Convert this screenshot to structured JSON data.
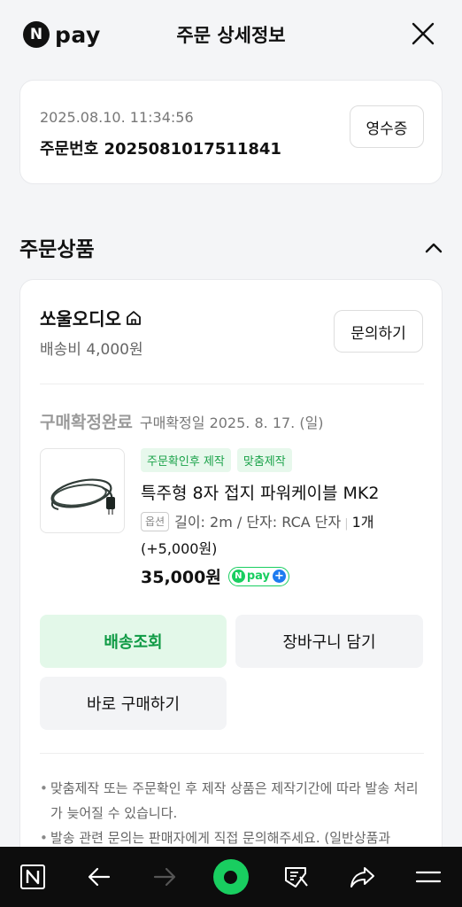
{
  "header": {
    "logo_letter": "N",
    "logo_text": "pay",
    "title": "주문 상세정보"
  },
  "order": {
    "datetime": "2025.08.10. 11:34:56",
    "number_label": "주문번호",
    "number": "2025081017511841",
    "receipt_label": "영수증"
  },
  "section": {
    "title": "주문상품"
  },
  "seller": {
    "name": "쏘울오디오",
    "shipping_fee": "배송비 4,000원",
    "inquiry_label": "문의하기"
  },
  "item": {
    "status": "구매확정완료",
    "confirm_date": "구매확정일 2025. 8. 17. (일)",
    "tags": [
      "주문확인후 제작",
      "맞춤제작"
    ],
    "name": "특주형 8자 접지 파워케이블 MK2",
    "option_badge": "옵션",
    "option_text": "길이: 2m / 단자: RCA 단자",
    "quantity_text": "1개 (+5,000원)",
    "price": "35,000원",
    "npay_letter": "N",
    "npay_text": "pay",
    "npay_plus": "+"
  },
  "actions": {
    "track": "배송조회",
    "cart": "장바구니 담기",
    "buy_now": "바로 구매하기"
  },
  "notices": [
    "맞춤제작 또는 주문확인 후 제작 상품은 제작기간에 따라 발송 처리가 늦어질 수 있습니다.",
    "발송 관련 문의는 판매자에게 직접 문의해주세요. (일반상품과"
  ],
  "colors": {
    "accent_green": "#19ce60",
    "track_button_bg": "#e3f8e9",
    "track_button_text": "#0e9a44",
    "npay_plus_blue": "#1e7bf0"
  },
  "bottom_nav": {
    "icons": [
      "naver-home-icon",
      "back-arrow-icon",
      "forward-arrow-icon",
      "green-dot-icon",
      "coupon-icon",
      "share-icon",
      "menu-icon"
    ]
  }
}
